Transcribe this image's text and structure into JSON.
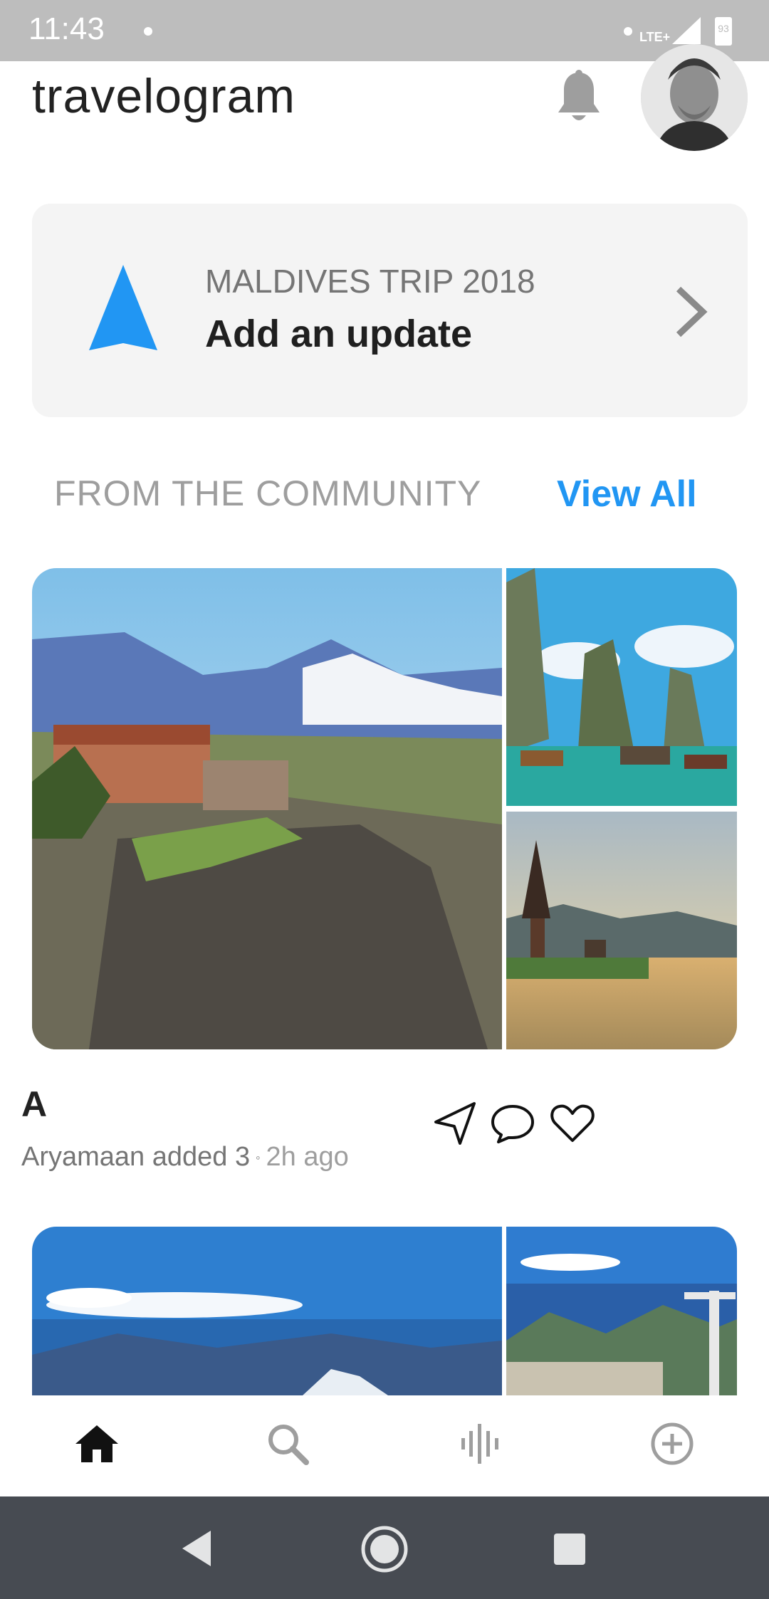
{
  "status_bar": {
    "time": "11:43",
    "network": "LTE+",
    "battery": "93"
  },
  "header": {
    "brand": "travelogram",
    "icons": [
      "bell-icon",
      "avatar"
    ]
  },
  "trip_card": {
    "subtitle": "MALDIVES TRIP 2018",
    "title": "Add an update",
    "icons": [
      "navigation-arrow-icon",
      "chevron-right-icon"
    ]
  },
  "community": {
    "title": "FROM THE COMMUNITY",
    "view_all": "View All"
  },
  "post": {
    "initial": "A",
    "author_text": "Aryamaan added 3",
    "separator": "◦",
    "time_ago": "2h ago",
    "actions": [
      "send-icon",
      "comment-icon",
      "like-icon"
    ]
  },
  "bottom_nav": {
    "items": [
      "home-icon",
      "search-icon",
      "activity-icon",
      "add-circle-icon"
    ],
    "active": "home-icon"
  },
  "system_nav": [
    "back-button",
    "home-button",
    "recents-button"
  ],
  "colors": {
    "accent": "#2196f3",
    "status_bar": "#bdbdbd",
    "card_bg": "#f4f4f4",
    "system_nav": "#474b52"
  }
}
